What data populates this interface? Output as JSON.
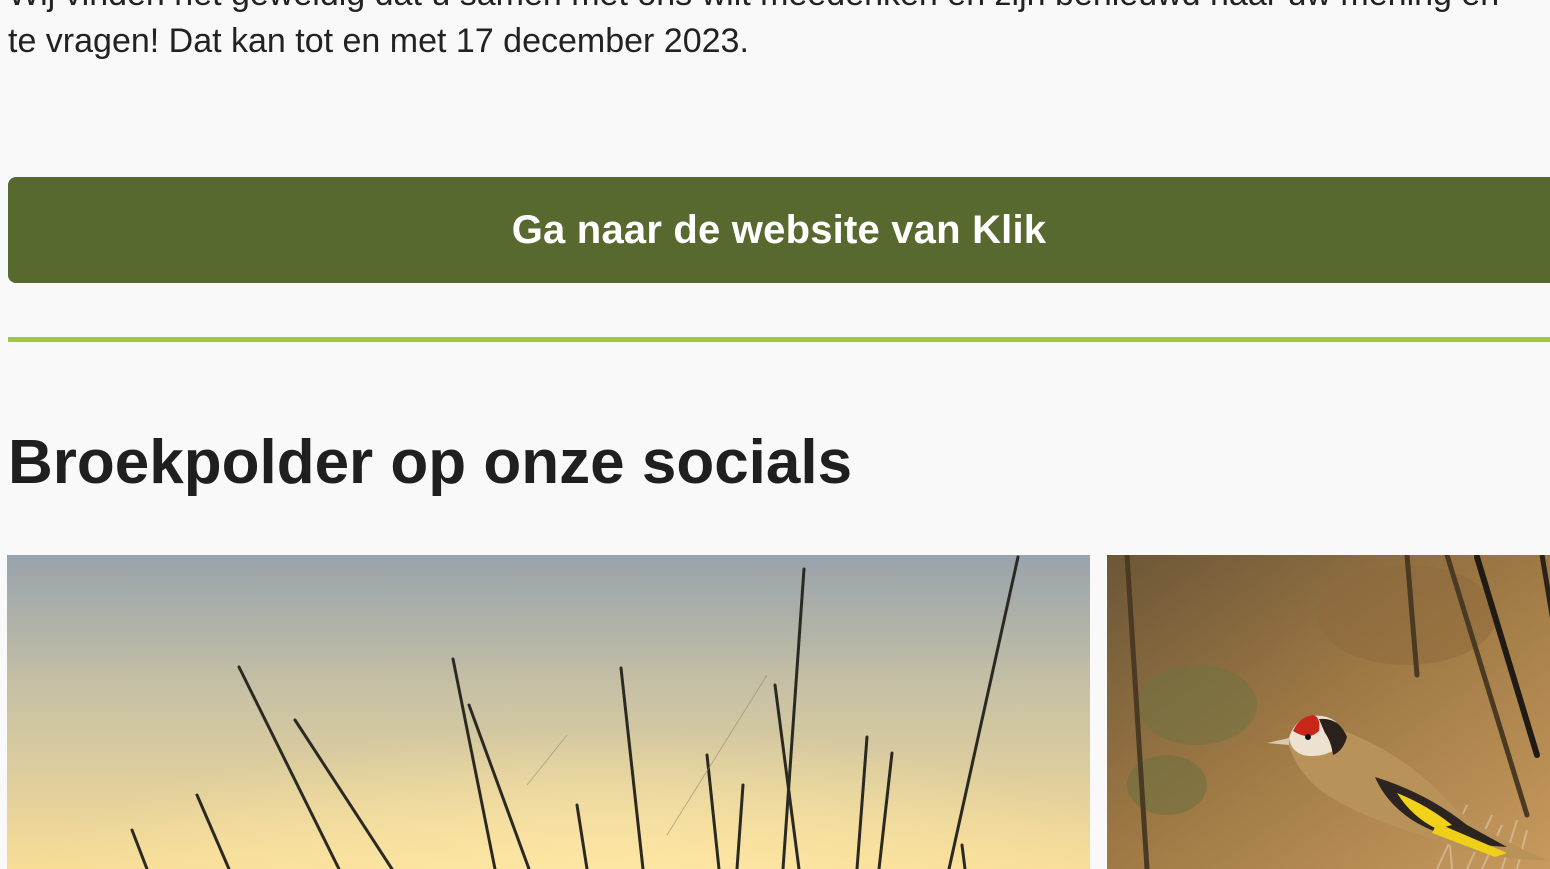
{
  "article": {
    "cut_line": "Wij vinden het geweldig dat u samen met ons wilt meedenken en zijn benieuwd naar uw mening en",
    "paragraph_end": "te vragen! Dat kan tot en met 17 december 2023."
  },
  "cta": {
    "label": "Ga naar de website van Klik"
  },
  "socials": {
    "title": "Broekpolder op onze socials",
    "posts": [
      {
        "subject": "reed stalks at sunset"
      },
      {
        "subject": "goldfinch on branch"
      }
    ]
  },
  "colors": {
    "background": "#f9f9f9",
    "button": "#58692f",
    "divider": "#a2c63f",
    "heading": "#1f1f1f"
  }
}
